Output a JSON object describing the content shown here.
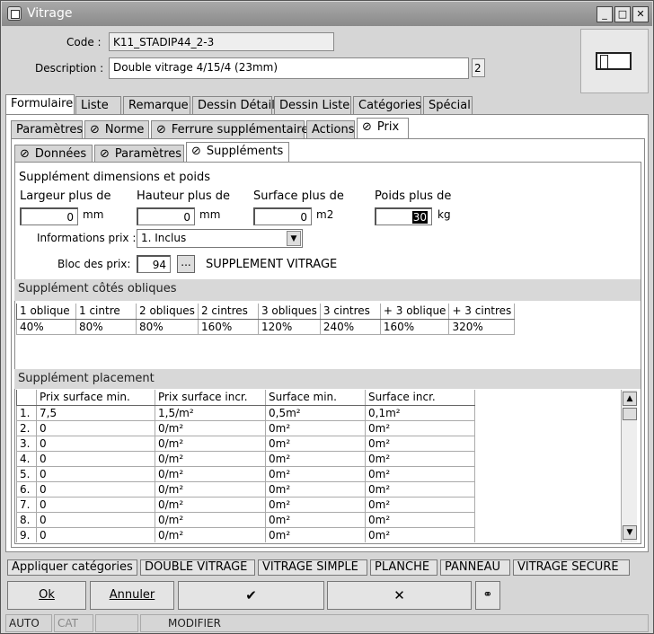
{
  "window": {
    "title": "Vitrage",
    "min": "_",
    "max": "□",
    "close": "✕"
  },
  "code": {
    "label": "Code :",
    "value": "K11_STADIP44_2-3"
  },
  "description": {
    "label": "Description :",
    "value": "Double vitrage  4/15/4 (23mm)",
    "lang": "2"
  },
  "tabs1": [
    "Formulaire",
    "Liste",
    "Remarque",
    "Dessin Détail",
    "Dessin Liste",
    "Catégories",
    "Spécial"
  ],
  "tabs2": [
    "Paramètres",
    "Norme",
    "Ferrure supplémentaire",
    "Actions",
    "Prix"
  ],
  "tabs3": [
    "Données",
    "Paramètres",
    "Suppléments"
  ],
  "supp": {
    "title": "Supplément dimensions et poids",
    "largeur": {
      "label": "Largeur plus de",
      "value": "0",
      "unit": "mm"
    },
    "hauteur": {
      "label": "Hauteur plus de",
      "value": "0",
      "unit": "mm"
    },
    "surface": {
      "label": "Surface plus de",
      "value": "0",
      "unit": "m2"
    },
    "poids": {
      "label": "Poids plus de",
      "value": "30",
      "unit": "kg"
    },
    "info_label": "Informations prix :",
    "info_value": "1.  Inclus",
    "bloc_label": "Bloc des prix:",
    "bloc_value": "94",
    "bloc_btn": "...",
    "bloc_text": "SUPPLEMENT VITRAGE"
  },
  "obliques": {
    "title": "Supplément côtés obliques",
    "headers": [
      "1 oblique",
      "1 cintre",
      "2 obliques",
      "2 cintres",
      "3 obliques",
      "3 cintres",
      "+ 3 oblique",
      "+ 3 cintres"
    ],
    "values": [
      "40%",
      "80%",
      "80%",
      "160%",
      "120%",
      "240%",
      "160%",
      "320%"
    ]
  },
  "placement": {
    "title": "Supplément placement",
    "headers": [
      "",
      "Prix surface min.",
      "Prix surface incr.",
      "Surface min.",
      "Surface incr."
    ],
    "rows": [
      [
        "1.",
        "7,5",
        "1,5/m²",
        "0,5m²",
        "0,1m²"
      ],
      [
        "2.",
        "0",
        "0/m²",
        "0m²",
        "0m²"
      ],
      [
        "3.",
        "0",
        "0/m²",
        "0m²",
        "0m²"
      ],
      [
        "4.",
        "0",
        "0/m²",
        "0m²",
        "0m²"
      ],
      [
        "5.",
        "0",
        "0/m²",
        "0m²",
        "0m²"
      ],
      [
        "6.",
        "0",
        "0/m²",
        "0m²",
        "0m²"
      ],
      [
        "7.",
        "0",
        "0/m²",
        "0m²",
        "0m²"
      ],
      [
        "8.",
        "0",
        "0/m²",
        "0m²",
        "0m²"
      ],
      [
        "9.",
        "0",
        "0/m²",
        "0m²",
        "0m²"
      ]
    ]
  },
  "categories": [
    "Appliquer catégories",
    "DOUBLE VITRAGE",
    "VITRAGE SIMPLE",
    "PLANCHE",
    "PANNEAU",
    "VITRAGE SECURE"
  ],
  "buttons": {
    "ok": "Ok",
    "cancel": "Annuler",
    "check": "✔",
    "cross": "✕"
  },
  "status": [
    "AUTO",
    "CAT",
    "",
    "MODIFIER"
  ]
}
